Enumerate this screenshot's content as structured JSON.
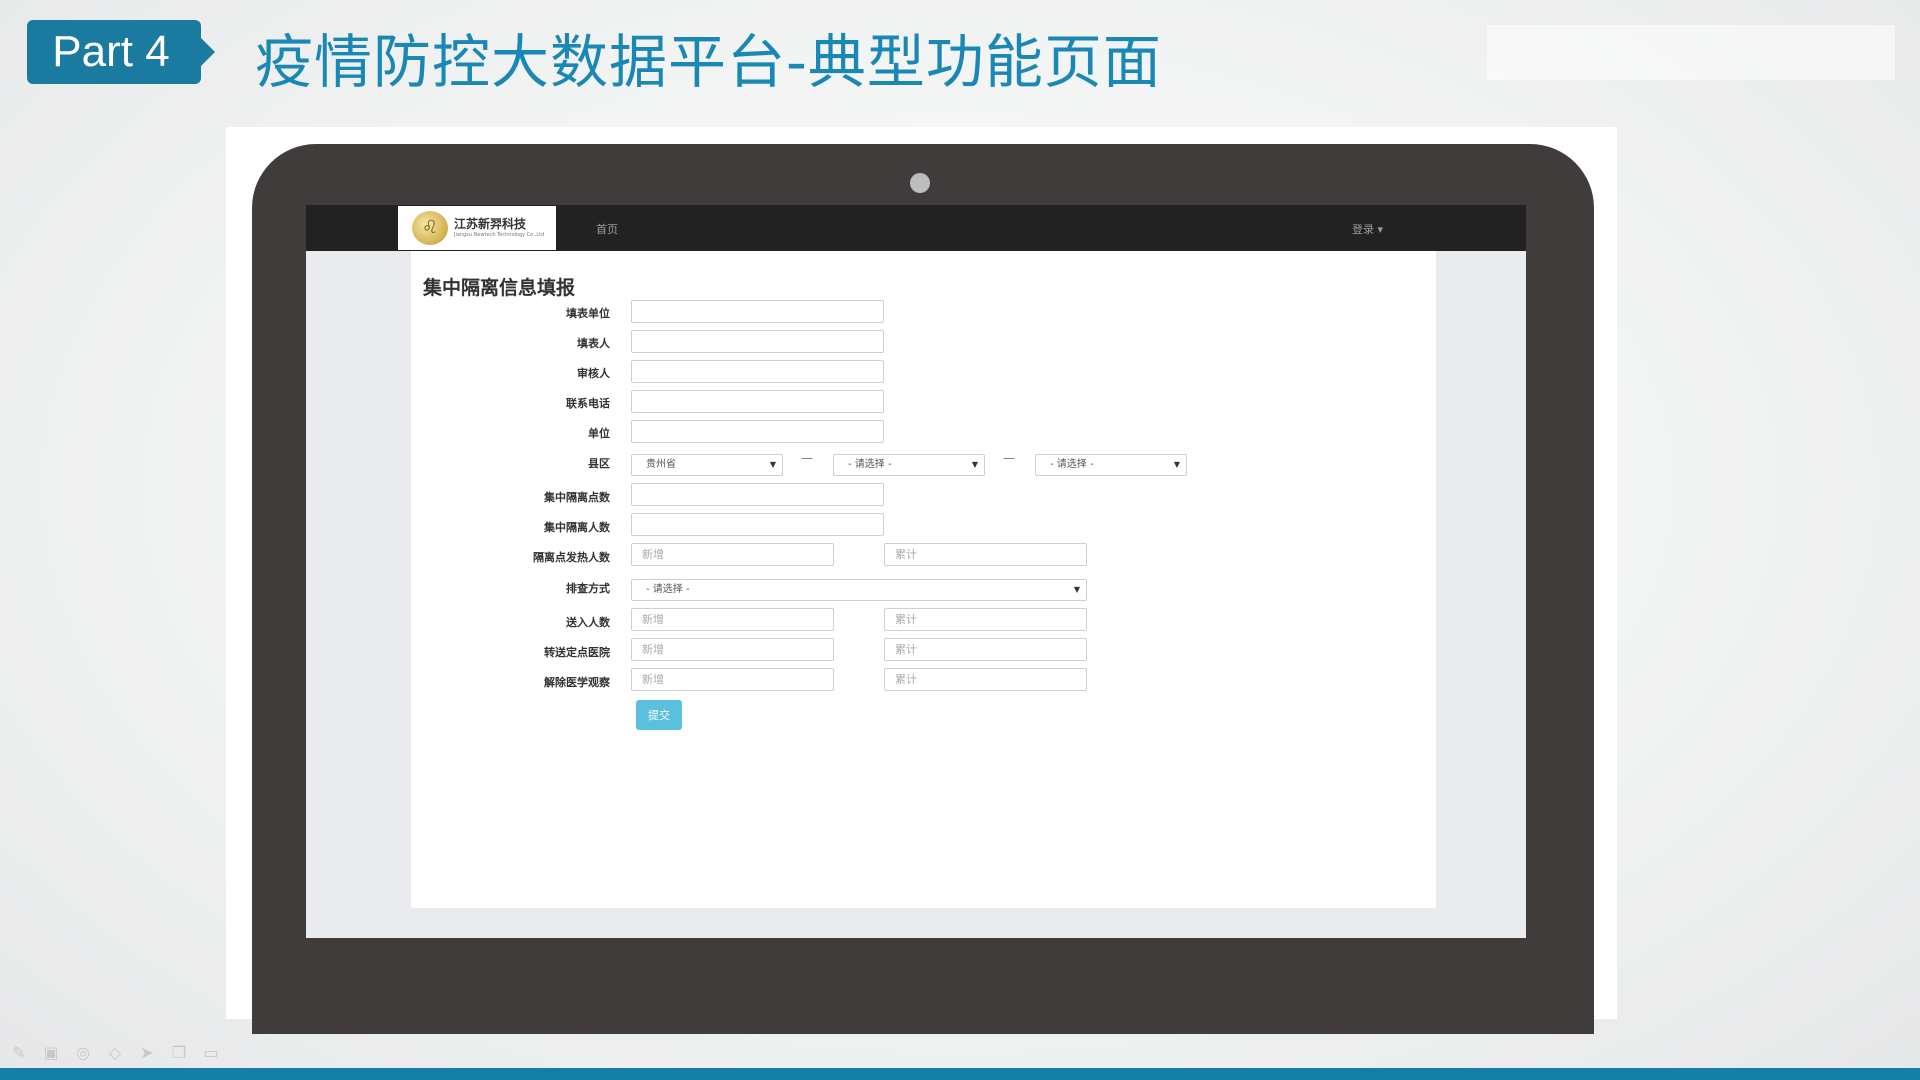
{
  "slide": {
    "part_label": "Part 4",
    "title": "疫情防控大数据平台-典型功能页面"
  },
  "app": {
    "logo_name": "江苏新羿科技",
    "logo_subtitle": "Jiangsu Newtech Technology Co.,Ltd",
    "nav_home": "首页",
    "nav_login": "登录 ▾"
  },
  "form": {
    "title": "集中隔离信息填报",
    "labels": {
      "fill_unit": "填表单位",
      "filler": "填表人",
      "reviewer": "审核人",
      "phone": "联系电话",
      "unit": "单位",
      "county": "县区",
      "isolation_points": "集中隔离点数",
      "isolation_people": "集中隔离人数",
      "fever_count": "隔离点发热人数",
      "screening_method": "排查方式",
      "admitted": "送入人数",
      "transferred": "转送定点医院",
      "released": "解除医学观察"
    },
    "county_selects": [
      "贵州省",
      "- 请选择 -",
      "- 请选择 -"
    ],
    "dash": "—",
    "screening_value": "- 请选择 -",
    "placeholder_new": "新增",
    "placeholder_total": "累计",
    "submit": "提交"
  },
  "icons": {
    "logo": "lion-logo-icon",
    "caret": "caret-down-icon",
    "toolbar": [
      "pen-icon",
      "image-icon",
      "eraser-icon",
      "highlighter-icon",
      "pointer-icon",
      "copy-icon",
      "screen-icon"
    ]
  },
  "colors": {
    "accent": "#1a7a9f",
    "title": "#1a88b5",
    "laptop": "#403c3b",
    "navbar": "#222222",
    "submit": "#5bc0de"
  }
}
